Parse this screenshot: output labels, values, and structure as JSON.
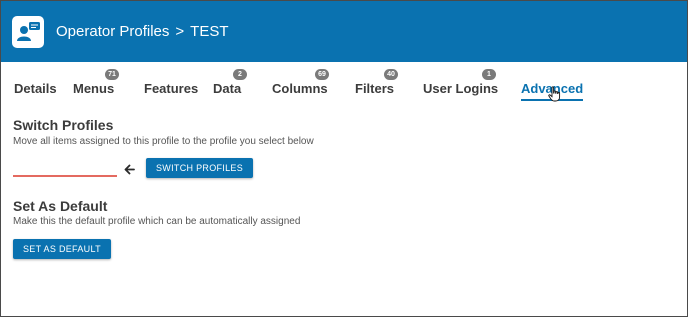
{
  "header": {
    "app_icon": "operator-profile-icon",
    "breadcrumb_parent": "Operator Profiles",
    "breadcrumb_separator": ">",
    "breadcrumb_current": "TEST"
  },
  "tabs": [
    {
      "label": "Details",
      "badge": null,
      "active": false
    },
    {
      "label": "Menus",
      "badge": "71",
      "active": false
    },
    {
      "label": "Features",
      "badge": null,
      "active": false
    },
    {
      "label": "Data",
      "badge": "2",
      "active": false
    },
    {
      "label": "Columns",
      "badge": "69",
      "active": false
    },
    {
      "label": "Filters",
      "badge": "40",
      "active": false
    },
    {
      "label": "User Logins",
      "badge": "1",
      "active": false
    },
    {
      "label": "Advanced",
      "badge": null,
      "active": true
    }
  ],
  "switch_profiles": {
    "title": "Switch Profiles",
    "description": "Move all items assigned to this profile to the profile you select below",
    "input_value": "",
    "arrow_icon": "arrow-left-icon",
    "button_label": "SWITCH PROFILES"
  },
  "set_default": {
    "title": "Set As Default",
    "description": "Make this the default profile which can be automatically assigned",
    "button_label": "SET AS DEFAULT"
  },
  "colors": {
    "primary": "#0a72b0",
    "badge": "#7a7a7a",
    "input_underline": "#e46a60"
  }
}
